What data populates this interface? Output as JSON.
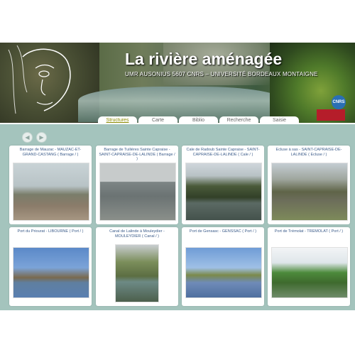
{
  "header": {
    "title": "La rivière aménagée",
    "subtitle": "UMR AUSONIUS 5607 CNRS – UNIVERSITÉ BORDEAUX MONTAIGNE",
    "logo_cnrs": "CNRS",
    "logo_ub": "UNIVERSITÉ BORDEAUX MONTAIGNE"
  },
  "tabs": [
    "Structures",
    "Carte",
    "Biblio",
    "Recherche",
    "Saisie"
  ],
  "active_tab": "Structures",
  "controls": {
    "prev_icon": "left-arrow-icon",
    "next_icon": "right-arrow-icon"
  },
  "cards": [
    {
      "caption": "Barrage de Mauzac - MAUZAC-ET-GRAND-CASTANG ( Barrage / )"
    },
    {
      "caption": "Barrage de Tuilières Sainte Capraise - SAINT-CAPRAISE-DE-LALINDE ( Barrage / )"
    },
    {
      "caption": "Cale de Radoub Sainte Capraise - SAINT-CAPRAISE-DE-LALINDE ( Cale / )"
    },
    {
      "caption": "Ecluse à sas - SAINT-CAPRAISE-DE-LALINDE ( Ecluse / )"
    },
    {
      "caption": "Port du Priourat - LIBOURNE ( Port / )"
    },
    {
      "caption": "Canal de Lalinde à Mouleydier - MOULEYDIER ( Canal / )"
    },
    {
      "caption": "Port de Gensasc - GENSSAC ( Port / )"
    },
    {
      "caption": "Port de Trémolat - TREMOLAT ( Port / )"
    }
  ]
}
